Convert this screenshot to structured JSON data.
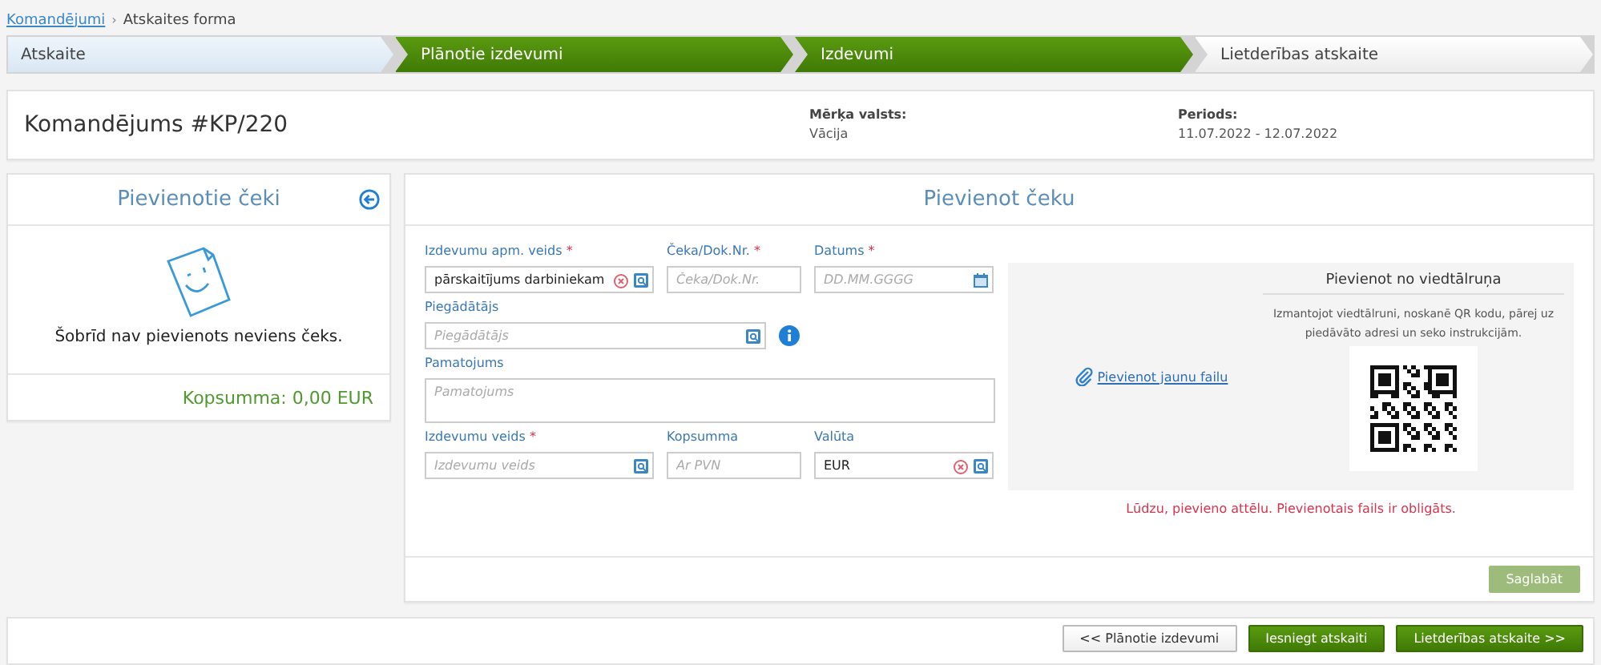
{
  "breadcrumb": [
    {
      "label": "Komandējumi",
      "link": true
    },
    {
      "label": "Atskaites forma",
      "link": false
    }
  ],
  "breadcrumb_separator": "›",
  "required_marker": "*",
  "steps": [
    {
      "label": "Atskaite",
      "kind": "done"
    },
    {
      "label": "Plānotie izdevumi",
      "kind": "current"
    },
    {
      "label": "Izdevumi",
      "kind": "current"
    },
    {
      "label": "Lietderības atskaite",
      "kind": "upcoming"
    }
  ],
  "header": {
    "title": "Komandējums #KP/220",
    "details": [
      {
        "label": "Mērķa valsts:",
        "value": "Vācija"
      },
      {
        "label": "Periods:",
        "value": "11.07.2022 - 12.07.2022"
      }
    ]
  },
  "receipts": {
    "title": "Pievienotie čeki",
    "empty_text": "Šobrīd nav pievienots neviens čeks.",
    "total": "Kopsumma: 0,00 EUR"
  },
  "form": {
    "title": "Pievienot čeku",
    "rows": [
      [
        {
          "label": "Izdevumu apm. veids",
          "required": true,
          "kind": "lookup",
          "value": "pārskaitījums darbiniekam",
          "clearable": true
        },
        {
          "label": "Čeka/Dok.Nr.",
          "required": true,
          "kind": "text",
          "placeholder": "Čeka/Dok.Nr."
        },
        {
          "label": "Datums",
          "required": true,
          "kind": "date",
          "placeholder": "DD.MM.GGGG"
        }
      ],
      [
        {
          "label": "Piegādātājs",
          "required": false,
          "kind": "lookup",
          "placeholder": "Piegādātājs",
          "info": true
        }
      ],
      [
        {
          "label": "Pamatojums",
          "required": false,
          "kind": "textarea",
          "placeholder": "Pamatojums"
        }
      ],
      [
        {
          "label": "Izdevumu veids",
          "required": true,
          "kind": "lookup",
          "placeholder": "Izdevumu veids"
        },
        {
          "label": "Kopsumma",
          "required": false,
          "kind": "text",
          "placeholder": "Ar PVN"
        },
        {
          "label": "Valūta",
          "required": false,
          "kind": "lookup",
          "value": "EUR",
          "clearable": true
        }
      ]
    ],
    "upload": {
      "link": "Pievienot jaunu failu",
      "phone_title": "Pievienot no viedtālruņa",
      "phone_text": "Izmantojot viedtālruni, noskanē QR kodu, pārej uz piedāvāto adresi un seko instrukcijām.",
      "error": "Lūdzu, pievieno attēlu. Pievienotais fails ir obligāts."
    },
    "save_button": {
      "label": "Saglabāt",
      "disabled": true
    }
  },
  "footer_buttons": [
    {
      "label": "<< Plānotie izdevumi",
      "kind": "secondary"
    },
    {
      "label": "Iesniegt atskaiti",
      "kind": "primary"
    },
    {
      "label": "Lietderības atskaite >>",
      "kind": "primary"
    }
  ]
}
